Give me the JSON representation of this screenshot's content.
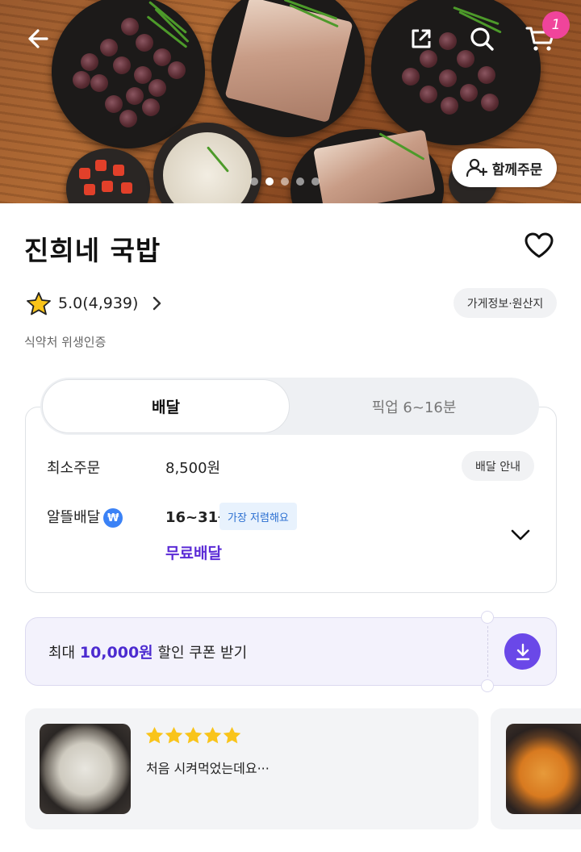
{
  "hero": {
    "cart_count": "1",
    "together_order_label": "함께주문",
    "slide_count": 5,
    "active_slide": 1
  },
  "store": {
    "name": "진희네 국밥",
    "rating_label": "5.0(4,939)",
    "info_chip": "가게정보·원산지",
    "hygiene": "식약처 위생인증"
  },
  "tabs": {
    "delivery": "배달",
    "pickup": "픽업  6~16분"
  },
  "delivery_info": {
    "min_order_label": "최소주문",
    "min_order_value": "8,500원",
    "delivery_guide": "배달 안내",
    "saver_label": "알뜰배달",
    "saver_icon_text": "₩",
    "time": "16~31분",
    "cheapest_badge": "가장 저렴해요",
    "fee": "무료배달"
  },
  "coupon": {
    "prefix": "최대 ",
    "amount": "10,000원",
    "suffix": " 할인 쿠폰 받기"
  },
  "reviews": [
    {
      "stars": 5,
      "text": "처음 시켜먹었는데요···"
    }
  ],
  "colors": {
    "accent_purple": "#6a48e8",
    "badge_pink": "#f0449b",
    "star_yellow": "#f9c41a",
    "blue_badge": "#3b82f6"
  },
  "icons": [
    "back-arrow-icon",
    "share-icon",
    "search-icon",
    "cart-icon",
    "add-person-icon",
    "heart-icon",
    "star-icon",
    "chevron-right-icon",
    "chevron-down-icon",
    "download-icon"
  ]
}
